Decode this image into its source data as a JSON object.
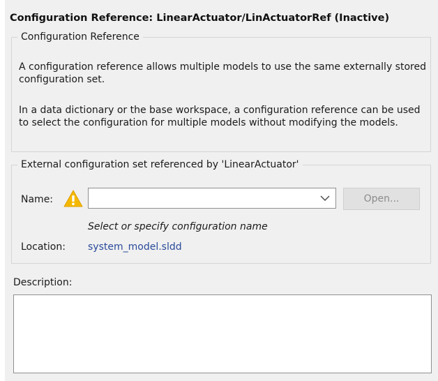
{
  "title": "Configuration Reference: LinearActuator/LinActuatorRef (Inactive)",
  "config_group": {
    "legend": "Configuration Reference",
    "paragraph1": "A configuration reference allows multiple models to use the same externally stored configuration set.",
    "paragraph2": "In a data dictionary or the base workspace, a configuration reference can be used to select the configuration for multiple models without modifying the models."
  },
  "external_group": {
    "legend": "External configuration set referenced by 'LinearActuator'",
    "name_label": "Name:",
    "name_value": "",
    "warning_icon": "warning-icon",
    "open_button": "Open...",
    "hint": "Select or specify configuration name",
    "location_label": "Location:",
    "location_value": "system_model.sldd"
  },
  "description": {
    "label": "Description:",
    "value": ""
  },
  "colors": {
    "panel_background": "#f0f0f0",
    "warning": "#f5b800",
    "link": "#2a4a9a"
  }
}
